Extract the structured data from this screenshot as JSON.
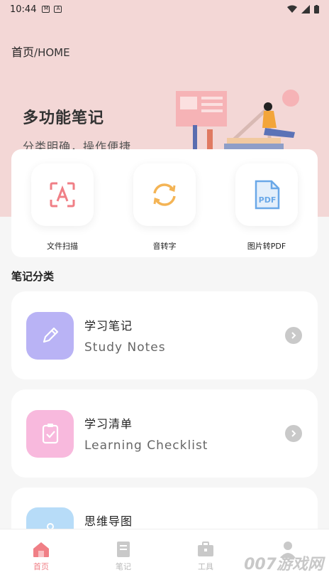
{
  "status_bar": {
    "time": "10:44"
  },
  "header": {
    "title": "首页",
    "subtitle": "/HOME"
  },
  "hero": {
    "title": "多功能笔记",
    "subtitle": "分类明确，操作便捷"
  },
  "tools": [
    {
      "label": "文件扫描",
      "icon": "scan-icon",
      "color": "#f07f86"
    },
    {
      "label": "音转字",
      "icon": "refresh-icon",
      "color": "#f4b455"
    },
    {
      "label": "图片转PDF",
      "icon": "pdf-icon",
      "color": "#6aa8e8"
    }
  ],
  "section": {
    "title": "笔记分类"
  },
  "notes": [
    {
      "title": "学习笔记",
      "subtitle": "Study Notes",
      "icon": "pencil-icon",
      "color": "#b9b3f5"
    },
    {
      "title": "学习清单",
      "subtitle": "Learning Checklist",
      "icon": "clipboard-check-icon",
      "color": "#f8b9dd"
    },
    {
      "title": "思维导图",
      "subtitle": "",
      "icon": "mindmap-icon",
      "color": "#b7dcf8"
    }
  ],
  "nav": [
    {
      "label": "首页",
      "icon": "home-icon",
      "active": true
    },
    {
      "label": "笔记",
      "icon": "notebook-icon",
      "active": false
    },
    {
      "label": "工具",
      "icon": "toolbox-icon",
      "active": false
    },
    {
      "label": "",
      "icon": "user-icon",
      "active": false
    }
  ],
  "watermark": "007游戏网",
  "colors": {
    "accent": "#f07f86",
    "hero_bg": "#f3d7d6",
    "page_bg": "#f6f6f6"
  }
}
